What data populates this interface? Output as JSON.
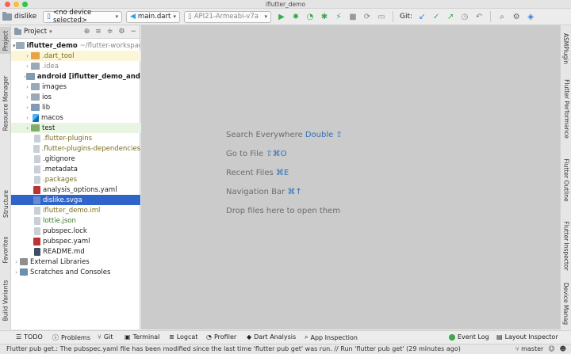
{
  "window": {
    "title": "iflutter_demo"
  },
  "toolbar": {
    "project": "dislike",
    "device": "<no device selected>",
    "run_config": "main.dart",
    "avd": "API21-Armeabi-v7a",
    "git_label": "Git:"
  },
  "left_tabs": [
    "Project",
    "Resource Manager",
    "Structure",
    "Favorites",
    "Build Variants"
  ],
  "right_tabs": [
    "ASMPlugin",
    "Flutter Performance",
    "Flutter Outline",
    "Flutter Inspector",
    "Device Manag"
  ],
  "panel": {
    "title": "Project"
  },
  "tree": [
    {
      "name": "iflutter_demo",
      "suffix": "~/flutter-workspac"
    },
    {
      "name": ".dart_tool"
    },
    {
      "name": ".idea"
    },
    {
      "name": "android",
      "suffix": "[iflutter_demo_androi"
    },
    {
      "name": "images"
    },
    {
      "name": "ios"
    },
    {
      "name": "lib"
    },
    {
      "name": "macos"
    },
    {
      "name": "test"
    },
    {
      "name": ".flutter-plugins"
    },
    {
      "name": ".flutter-plugins-dependencies"
    },
    {
      "name": ".gitignore"
    },
    {
      "name": ".metadata"
    },
    {
      "name": ".packages"
    },
    {
      "name": "analysis_options.yaml"
    },
    {
      "name": "dislike.svga"
    },
    {
      "name": "iflutter_demo.iml"
    },
    {
      "name": "lottie.json"
    },
    {
      "name": "pubspec.lock"
    },
    {
      "name": "pubspec.yaml"
    },
    {
      "name": "README.md"
    },
    {
      "name": "External Libraries"
    },
    {
      "name": "Scratches and Consoles"
    }
  ],
  "editor_hints": [
    {
      "text": "Search Everywhere",
      "key": "Double ⇧"
    },
    {
      "text": "Go to File",
      "key": "⇧⌘O"
    },
    {
      "text": "Recent Files",
      "key": "⌘E"
    },
    {
      "text": "Navigation Bar",
      "key": "⌘↑"
    },
    {
      "text": "Drop files here to open them",
      "key": ""
    }
  ],
  "bottom_tools": [
    "TODO",
    "Problems",
    "Git",
    "Terminal",
    "Logcat",
    "Profiler",
    "Dart Analysis",
    "App Inspection",
    "Event Log",
    "Layout Inspector"
  ],
  "status": {
    "message": "Flutter pub get.: The pubspec.yaml file has been modified since the last time 'flutter pub get' was run. // Run 'flutter pub get' (29 minutes ago)",
    "branch": "master"
  }
}
